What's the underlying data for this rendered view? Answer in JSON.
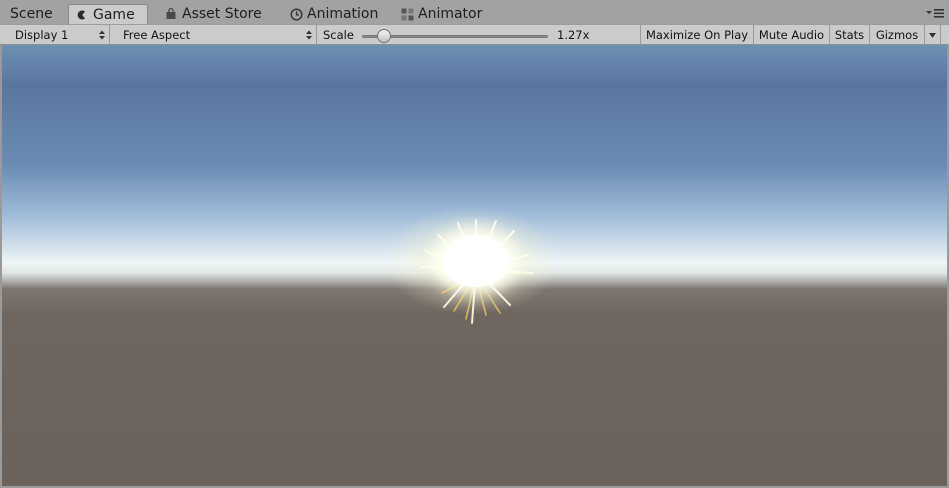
{
  "tabs": [
    {
      "label": "Scene",
      "icon": "none",
      "active": false
    },
    {
      "label": "Game",
      "icon": "game-controller-icon",
      "active": true
    },
    {
      "label": "Asset Store",
      "icon": "shopping-bag-icon",
      "active": false
    },
    {
      "label": "Animation",
      "icon": "clock-icon",
      "active": false
    },
    {
      "label": "Animator",
      "icon": "animator-nodes-icon",
      "active": false
    }
  ],
  "toolbar": {
    "display_select": "Display 1",
    "aspect_select": "Free Aspect",
    "scale_label": "Scale",
    "scale_value": "1.27x",
    "scale_slider_fraction": 0.12,
    "maximize_label": "Maximize On Play",
    "mute_label": "Mute Audio",
    "stats_label": "Stats",
    "gizmos_label": "Gizmos"
  },
  "colors": {
    "tab_strip": "#a2a2a2",
    "toolbar": "#cbcbcb",
    "sky_top": "#5a76a0",
    "horizon": "#eef5f7",
    "ground": "#6b625c",
    "sun": "#ffffff"
  }
}
